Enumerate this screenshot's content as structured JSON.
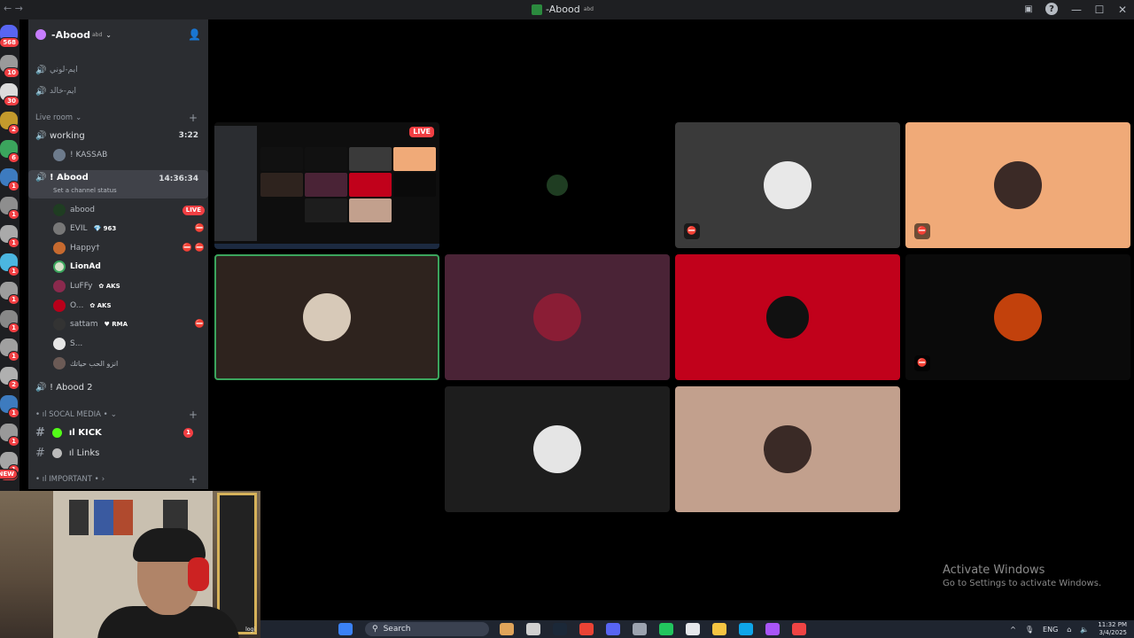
{
  "window": {
    "title": "-Abood",
    "title_sup": "abd",
    "nav_arrows": "← →",
    "controls": [
      "—",
      "☐",
      "✕"
    ]
  },
  "server_rail": {
    "badges": [
      "568",
      "10",
      "30",
      "2",
      "6",
      "1",
      "1",
      "1",
      "1",
      "1",
      "1",
      "1",
      "2",
      "1",
      "1",
      "1",
      "1",
      "NEW"
    ]
  },
  "server": {
    "name": "-Abood",
    "name_sup": "abd",
    "chevron": "⌄"
  },
  "channels": {
    "top_voice": [
      {
        "name": "ايم-لوني"
      },
      {
        "name": "ايم-خالد"
      }
    ],
    "live_category": "Live room",
    "working": {
      "name": "working",
      "time": "3:22",
      "member": "! KASSAB"
    },
    "abood": {
      "name": "! Abood",
      "time": "14:36:34",
      "status": "Set a channel status"
    },
    "members": [
      {
        "name": "abood",
        "tag": "",
        "live": "LIVE",
        "icons": ""
      },
      {
        "name": "EVIL",
        "tag": "💎 963",
        "live": "",
        "icons": "⛔"
      },
      {
        "name": "Happy†",
        "tag": "",
        "live": "",
        "icons": "⛔ ⛔"
      },
      {
        "name": "LionAd",
        "tag": "",
        "live": "",
        "icons": ""
      },
      {
        "name": "LuFFy",
        "tag": "✿ AKS",
        "live": "",
        "icons": ""
      },
      {
        "name": "O...",
        "tag": "✿ AKS",
        "live": "",
        "icons": ""
      },
      {
        "name": "sattam",
        "tag": "♥ RMA",
        "live": "",
        "icons": "⛔"
      },
      {
        "name": "S...",
        "tag": "",
        "live": "",
        "icons": ""
      },
      {
        "name": "انزو الحب حياتك",
        "tag": "",
        "live": "",
        "icons": ""
      }
    ],
    "abood2": "! Abood 2",
    "social_category": "• ıl SOCAL MEDIA •",
    "kick": {
      "name": "ıl KICK",
      "unread": "1"
    },
    "links": "ıl Links",
    "important_category": "• ıl IMPORTANT •"
  },
  "stream": {
    "live_label": "LIVE"
  },
  "tiles": [
    {
      "color": "#000000",
      "mic": ""
    },
    {
      "color": "#3a3a3a",
      "mic": "⛔"
    },
    {
      "color": "#f0aa78",
      "mic": "⛔"
    },
    {
      "color": "#2e231e",
      "mic": ""
    },
    {
      "color": "#4a2336",
      "mic": ""
    },
    {
      "color": "#c1011b",
      "mic": ""
    },
    {
      "color": "#0a0a0a",
      "mic": "⛔"
    },
    {
      "color": "#1d1d1d",
      "mic": ""
    },
    {
      "color": "#c2a08d",
      "mic": ""
    }
  ],
  "webcam": {
    "logo": "logi"
  },
  "watermark": {
    "title": "Activate Windows",
    "subtitle": "Go to Settings to activate Windows."
  },
  "taskbar": {
    "search_label": "Search",
    "lang": "ENG",
    "time": "11:32 PM",
    "date": "3/4/2025"
  }
}
